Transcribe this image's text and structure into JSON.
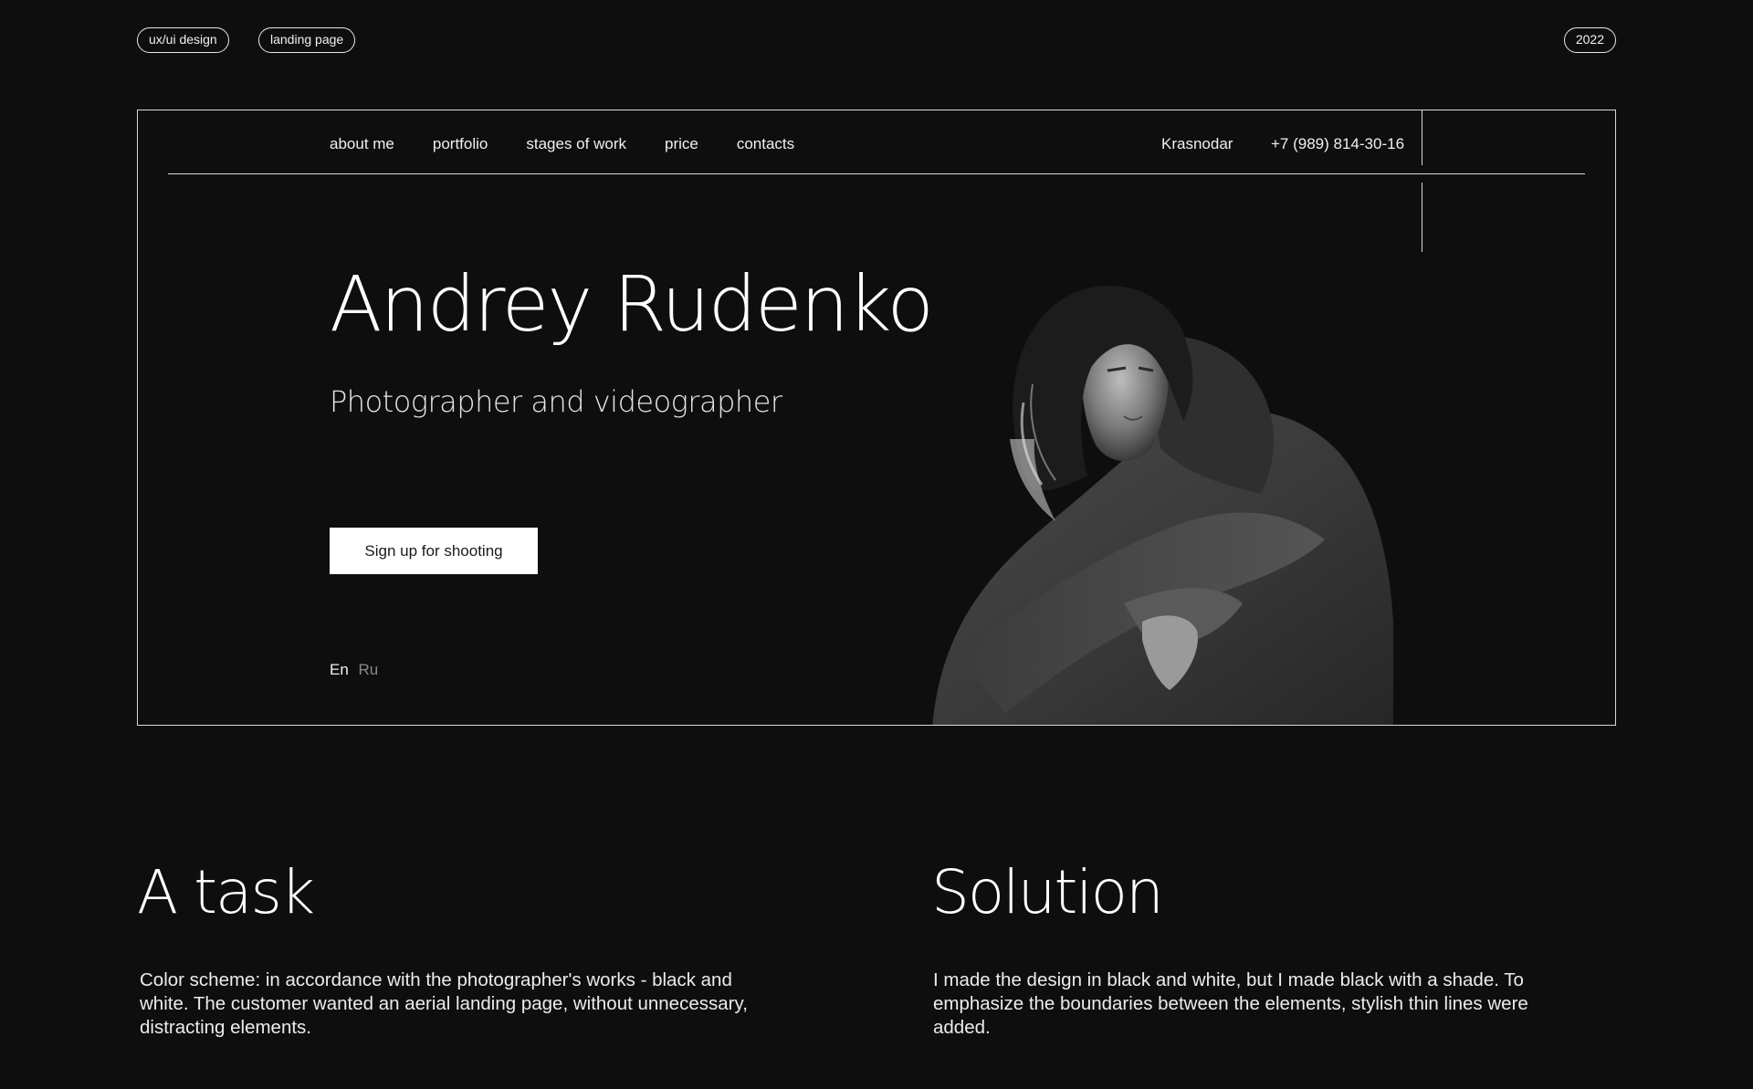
{
  "tags": {
    "category": "ux/ui design",
    "type": "landing page",
    "year": "2022"
  },
  "nav": {
    "items": [
      "about me",
      "portfolio",
      "stages of work",
      "price",
      "contacts"
    ],
    "city": "Krasnodar",
    "phone": "+7 (989) 814-30-16"
  },
  "hero": {
    "name": "Andrey Rudenko",
    "subtitle": "Photographer and videographer",
    "cta_label": "Sign up for shooting",
    "lang_en": "En",
    "lang_ru": "Ru"
  },
  "task": {
    "title": "A task",
    "text": "Color scheme: in accordance with the photographer's works - black and white. The customer wanted an aerial landing page, without unnecessary, distracting elements."
  },
  "solution": {
    "title": "Solution",
    "text": "I made the design in black and white, but I made black with a shade. To emphasize the boundaries between the elements, stylish thin lines were added."
  },
  "colors": {
    "background": "#0e0e0e",
    "foreground": "#ffffff",
    "muted": "#8a8a8a"
  }
}
